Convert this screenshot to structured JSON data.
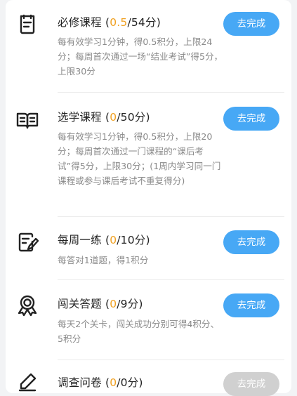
{
  "tasks": [
    {
      "name": "必修课程",
      "current": "0.5",
      "total": "/54分)",
      "open": " (",
      "desc": "每有效学习1分钟，得0.5积分，上限24分；每周首次通过一场“结业考试”得5分，上限30分",
      "button": "去完成",
      "icon": "checklist-icon"
    },
    {
      "name": "选学课程",
      "current": "0",
      "total": "/50分)",
      "open": " (",
      "desc": "每有效学习1分钟，得0.5积分，上限20分；每周首次通过一门课程的“课后考试”得5分，上限30分；(1周内学习同一门课程或参与课后考试不重复得分)",
      "button": "去完成",
      "icon": "open-book-icon"
    },
    {
      "name": "每周一练",
      "current": "0",
      "total": "/10分)",
      "open": " (",
      "desc": "每答对1道题，得1积分",
      "button": "去完成",
      "icon": "edit-document-icon"
    },
    {
      "name": "闯关答题",
      "current": "0",
      "total": "/9分)",
      "open": " (",
      "desc": "每天2个关卡，闯关成功分别可得4积分、5积分",
      "button": "去完成",
      "icon": "award-ribbon-icon"
    },
    {
      "name": "调查问卷",
      "current": "0",
      "total": "/0分)",
      "open": " (",
      "desc": "",
      "button": "去完成",
      "icon": "pen-icon"
    }
  ],
  "colors": {
    "accent": "#47a8f5",
    "progress": "#f0a020",
    "disabled": "#d0d0d0"
  }
}
